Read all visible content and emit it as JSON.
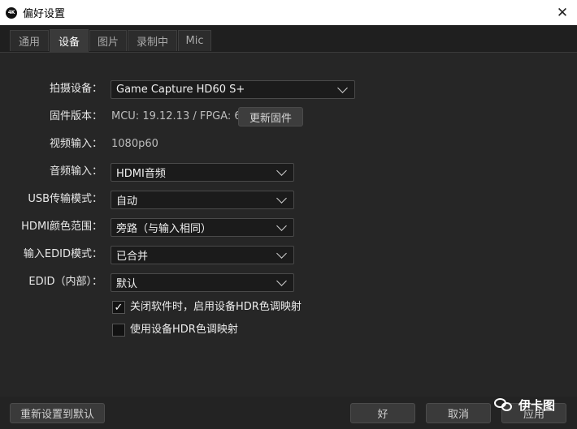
{
  "window": {
    "title": "偏好设置",
    "app_icon_text": "4K",
    "close_glyph": "✕"
  },
  "tabs": [
    {
      "label": "通用"
    },
    {
      "label": "设备",
      "active": true
    },
    {
      "label": "图片"
    },
    {
      "label": "录制中"
    },
    {
      "label": "Mic"
    }
  ],
  "form": {
    "capture_device": {
      "label": "拍摄设备：",
      "value": "Game Capture HD60 S+"
    },
    "firmware": {
      "label": "固件版本：",
      "value": "MCU: 19.12.13 / FPGA: 66",
      "button": "更新固件"
    },
    "video_input": {
      "label": "视频输入：",
      "value": "1080p60"
    },
    "audio_input": {
      "label": "音频输入：",
      "value": "HDMI音频"
    },
    "usb_mode": {
      "label": "USB传输模式：",
      "value": "自动"
    },
    "hdmi_color_range": {
      "label": "HDMI颜色范围：",
      "value": "旁路（与输入相同）"
    },
    "edid_mode": {
      "label": "输入EDID模式：",
      "value": "已合并"
    },
    "edid_internal": {
      "label": "EDID（内部）：",
      "value": "默认"
    },
    "checkbox_hdr_on_close": {
      "label": "关闭软件时，启用设备HDR色调映射",
      "checked": true,
      "mark": "✓"
    },
    "checkbox_use_hdr": {
      "label": "使用设备HDR色调映射",
      "checked": false
    }
  },
  "footer": {
    "reset": "重新设置到默认",
    "ok": "好",
    "cancel": "取消",
    "apply": "应用"
  },
  "watermark": {
    "text": "伊卡图"
  },
  "colors": {
    "background": "#262626",
    "titlebar": "#ffffff",
    "field": "#1b1b1b"
  }
}
